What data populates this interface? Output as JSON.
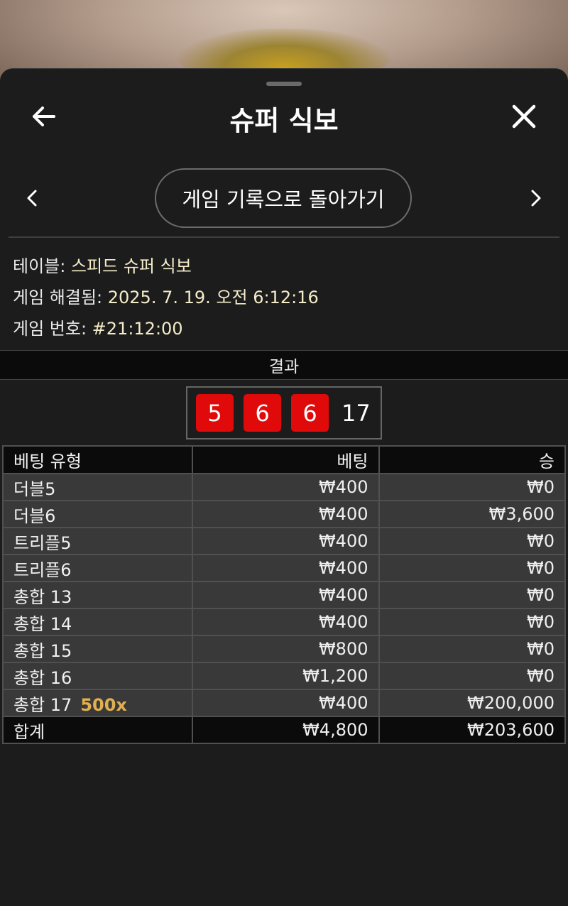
{
  "header": {
    "title": "슈퍼 식보"
  },
  "nav": {
    "back_to_history": "게임 기록으로 돌아가기"
  },
  "info": {
    "table_label": "테이블: ",
    "table_value": "스피드 슈퍼 식보",
    "resolved_label": "게임 해결됨: ",
    "resolved_value": "2025. 7. 19. 오전 6:12:16",
    "game_no_label": "게임 번호: ",
    "game_no_value": "#21:12:00"
  },
  "results": {
    "label": "결과",
    "dice": [
      "5",
      "6",
      "6"
    ],
    "total": "17"
  },
  "bets_table": {
    "headers": [
      "베팅 유형",
      "베팅",
      "승"
    ],
    "rows": [
      {
        "type": "더블5",
        "multiplier": "",
        "bet": "₩400",
        "win": "₩0"
      },
      {
        "type": "더블6",
        "multiplier": "",
        "bet": "₩400",
        "win": "₩3,600"
      },
      {
        "type": "트리플5",
        "multiplier": "",
        "bet": "₩400",
        "win": "₩0"
      },
      {
        "type": "트리플6",
        "multiplier": "",
        "bet": "₩400",
        "win": "₩0"
      },
      {
        "type": "총합 13",
        "multiplier": "",
        "bet": "₩400",
        "win": "₩0"
      },
      {
        "type": "총합 14",
        "multiplier": "",
        "bet": "₩400",
        "win": "₩0"
      },
      {
        "type": "총합 15",
        "multiplier": "",
        "bet": "₩800",
        "win": "₩0"
      },
      {
        "type": "총합 16",
        "multiplier": "",
        "bet": "₩1,200",
        "win": "₩0"
      },
      {
        "type": "총합 17",
        "multiplier": "500x",
        "bet": "₩400",
        "win": "₩200,000"
      }
    ],
    "total": {
      "label": "합계",
      "bet": "₩4,800",
      "win": "₩203,600"
    }
  },
  "colors": {
    "die_red": "#e10a0a",
    "highlight_value": "#f4ecc8",
    "multiplier_gold": "#e0b050",
    "sheet_bg": "#1c1c1c"
  },
  "icons": {
    "back": "arrow-left-icon",
    "close": "close-icon",
    "prev": "chevron-left-icon",
    "next": "chevron-right-icon"
  }
}
